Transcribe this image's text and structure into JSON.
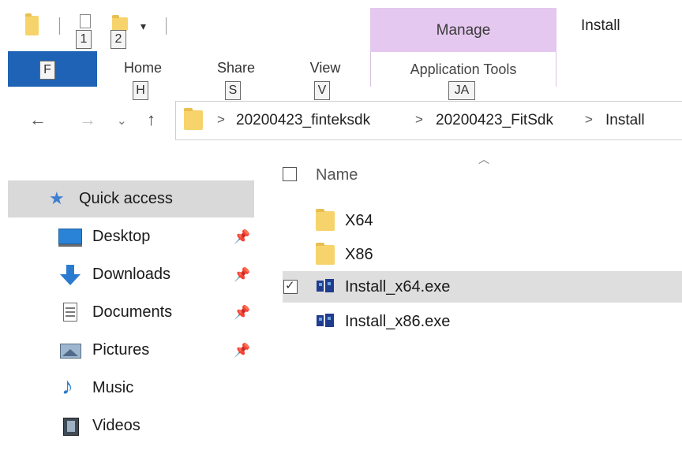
{
  "qat": {
    "keytips": [
      "1",
      "2"
    ],
    "dropdown_glyph": "▾"
  },
  "ribbon": {
    "file_label": "F",
    "tabs": [
      {
        "label": "Home",
        "keytip": "H"
      },
      {
        "label": "Share",
        "keytip": "S"
      },
      {
        "label": "View",
        "keytip": "V"
      }
    ],
    "contextual_group": "Manage",
    "contextual_tab": {
      "label": "Application Tools",
      "keytip": "JA"
    },
    "window_title": "Install"
  },
  "address": {
    "crumbs": [
      "20200423_finteksdk",
      "20200423_FitSdk",
      "Install"
    ],
    "separator": ">"
  },
  "nav_pane": {
    "quick_access": "Quick access",
    "items": [
      {
        "label": "Desktop",
        "icon": "desktop-icon",
        "pinned": true
      },
      {
        "label": "Downloads",
        "icon": "downloads-icon",
        "pinned": true
      },
      {
        "label": "Documents",
        "icon": "documents-icon",
        "pinned": true
      },
      {
        "label": "Pictures",
        "icon": "pictures-icon",
        "pinned": true
      },
      {
        "label": "Music",
        "icon": "music-icon",
        "pinned": false
      },
      {
        "label": "Videos",
        "icon": "videos-icon",
        "pinned": false
      }
    ]
  },
  "file_list": {
    "column_name": "Name",
    "files": [
      {
        "name": "X64",
        "type": "folder",
        "selected": false
      },
      {
        "name": "X86",
        "type": "folder",
        "selected": false
      },
      {
        "name": "Install_x64.exe",
        "type": "exe",
        "selected": true
      },
      {
        "name": "Install_x86.exe",
        "type": "exe",
        "selected": false
      }
    ]
  },
  "colors": {
    "file_tab": "#1f63b6",
    "manage_tab": "#e5c8ef",
    "selection": "#dedede",
    "quick_access_highlight": "#d9d9d9",
    "folder": "#f6d46b"
  }
}
